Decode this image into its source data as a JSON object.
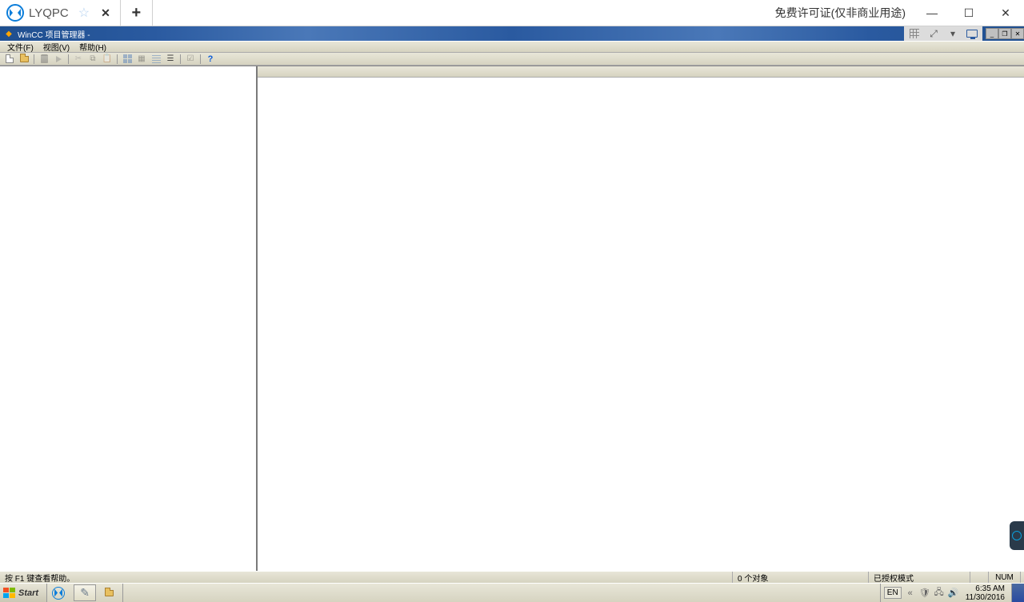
{
  "teamviewer": {
    "tab_name": "LYQPC",
    "license_text": "免费许可证(仅非商业用途)"
  },
  "remote_window": {
    "title": "WinCC 项目管理器 -"
  },
  "menu": {
    "file": "文件(F)",
    "view": "视图(V)",
    "help": "帮助(H)"
  },
  "status": {
    "help_hint": "按 F1 键查看帮助。",
    "object_count": "0 个对象",
    "mode": "已授权模式",
    "num": "NUM"
  },
  "taskbar": {
    "start": "Start",
    "lang": "EN",
    "time": "6:35 AM",
    "date": "11/30/2016"
  }
}
